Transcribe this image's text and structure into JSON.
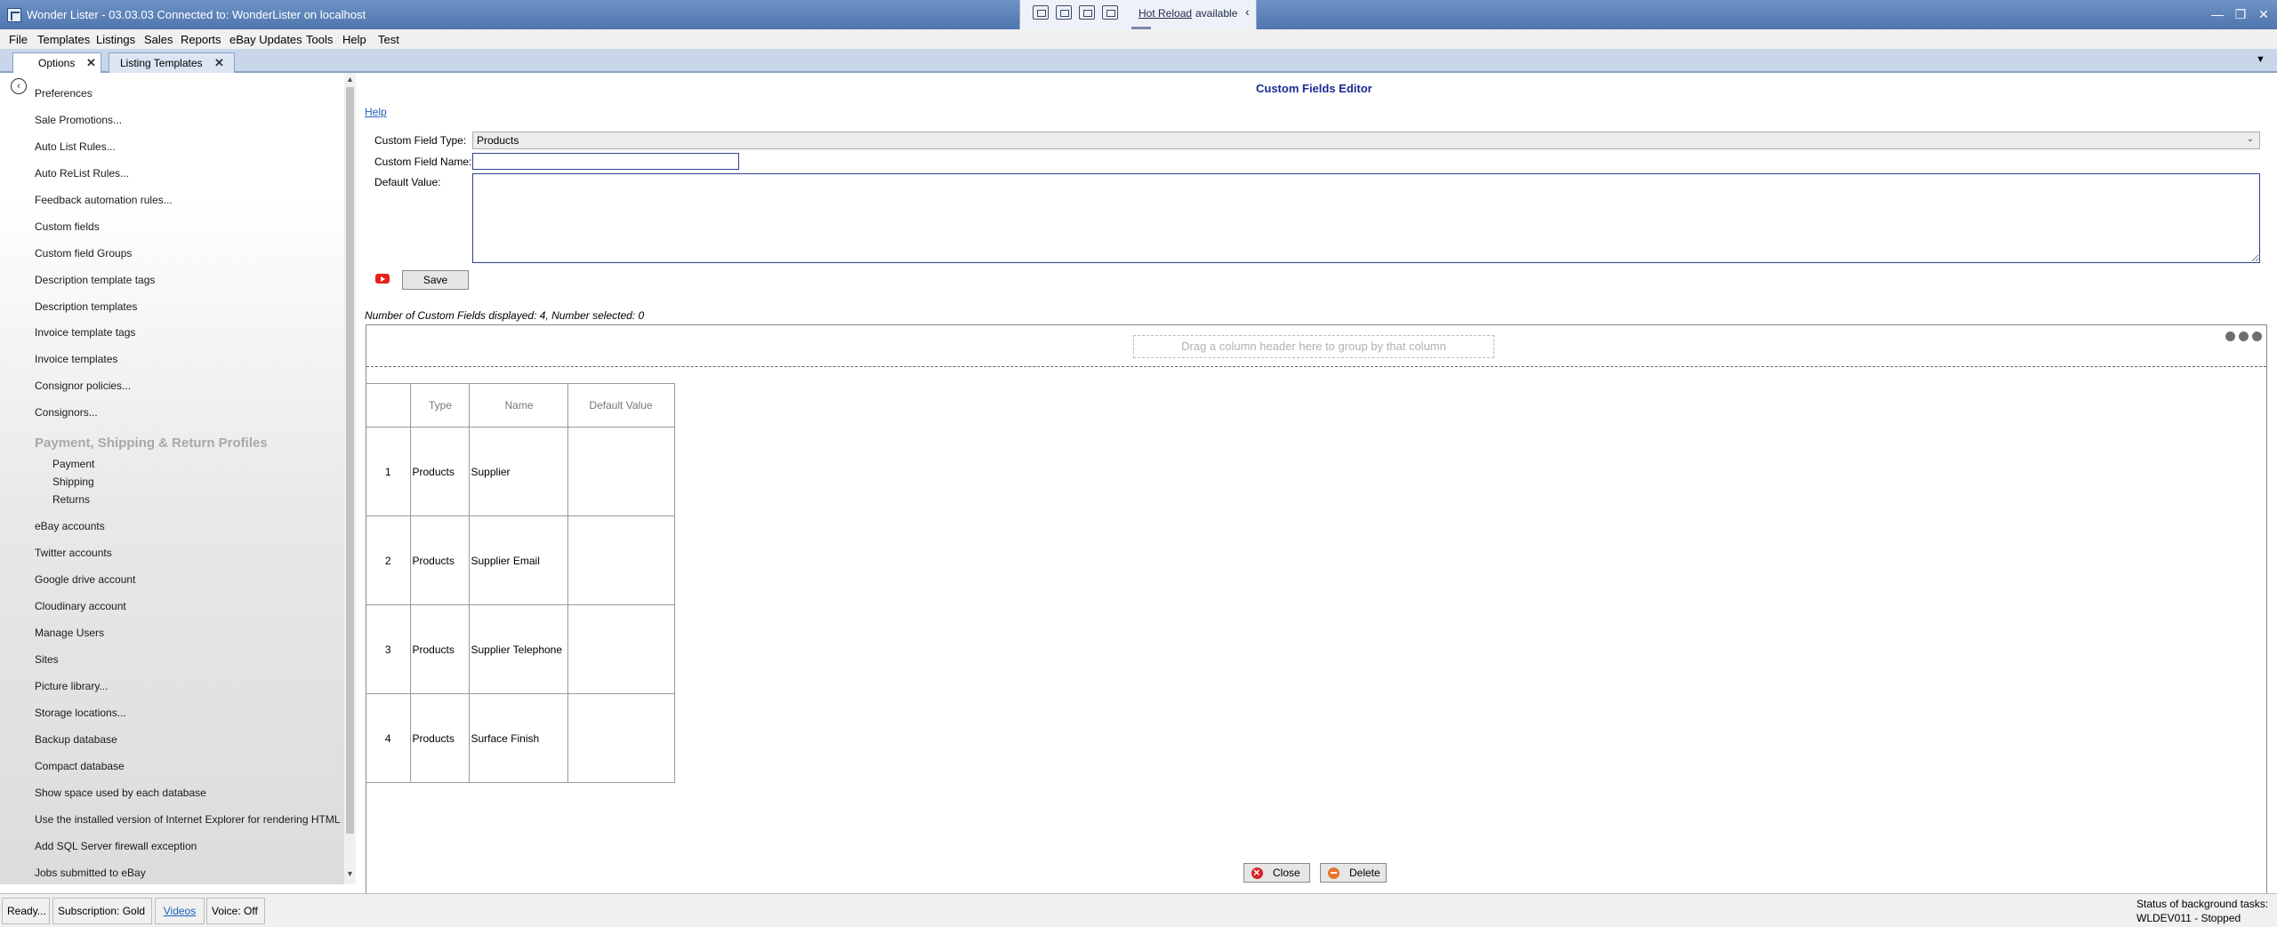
{
  "window": {
    "title": "Wonder Lister - 03.03.03 Connected to: WonderLister on localhost",
    "minimize": "—",
    "maximize": "❐",
    "close": "✕"
  },
  "hot_reload": {
    "link": "Hot Reload",
    "status": "available",
    "collapse": "‹"
  },
  "menu": [
    "File",
    "Templates",
    "Listings",
    "Sales",
    "Reports",
    "eBay Updates",
    "Tools",
    "Help",
    "Test"
  ],
  "tabs": [
    {
      "label": "Options",
      "close": "✕"
    },
    {
      "label": "Listing Templates",
      "close": "✕"
    }
  ],
  "tabstrip_menu": "▼",
  "sidebar": {
    "back": "‹",
    "items_top": [
      "Preferences",
      "Sale Promotions...",
      "Auto List Rules...",
      "Auto ReList Rules...",
      "Feedback automation rules...",
      "Custom fields",
      "Custom field Groups",
      "Description template tags",
      "Description templates",
      "Invoice template tags",
      "Invoice templates",
      "Consignor policies...",
      "Consignors..."
    ],
    "profiles_heading": "Payment, Shipping & Return Profiles",
    "profiles": [
      "Payment",
      "Shipping",
      "Returns"
    ],
    "items_bottom": [
      "eBay accounts",
      "Twitter accounts",
      "Google drive account",
      "Cloudinary account",
      "Manage Users",
      "Sites",
      "Picture library...",
      "Storage locations...",
      "Backup database",
      "Compact database",
      "Show space used by each database",
      "Use the installed version of Internet Explorer for rendering HTML",
      "Add SQL Server firewall exception",
      "Jobs submitted to eBay"
    ],
    "scroll_up": "▲",
    "scroll_down": "▼"
  },
  "editor": {
    "title": "Custom Fields Editor",
    "help": "Help",
    "type_label": "Custom Field Type:",
    "type_value": "Products",
    "type_chevron": "⌄",
    "name_label": "Custom Field Name:",
    "name_value": "",
    "default_label": "Default Value:",
    "default_value": "",
    "save": "Save",
    "count_text": "Number of Custom Fields displayed: 4, Number selected: 0"
  },
  "grid": {
    "group_hint": "Drag a column header here to group by that column",
    "columns": [
      "",
      "Type",
      "Name",
      "Default Value"
    ],
    "rows": [
      {
        "index": "1",
        "type": "Products",
        "name": "Supplier",
        "default": ""
      },
      {
        "index": "2",
        "type": "Products",
        "name": "Supplier Email",
        "default": ""
      },
      {
        "index": "3",
        "type": "Products",
        "name": "Supplier Telephone",
        "default": ""
      },
      {
        "index": "4",
        "type": "Products",
        "name": "Surface Finish",
        "default": ""
      }
    ]
  },
  "buttons": {
    "close": "Close",
    "delete": "Delete"
  },
  "status": {
    "ready": "Ready...",
    "subscription": "Subscription: Gold",
    "videos": "Videos",
    "voice": "Voice:  Off",
    "bg_label": "Status of background tasks:",
    "bg_value": "WLDEV011 - Stopped"
  }
}
